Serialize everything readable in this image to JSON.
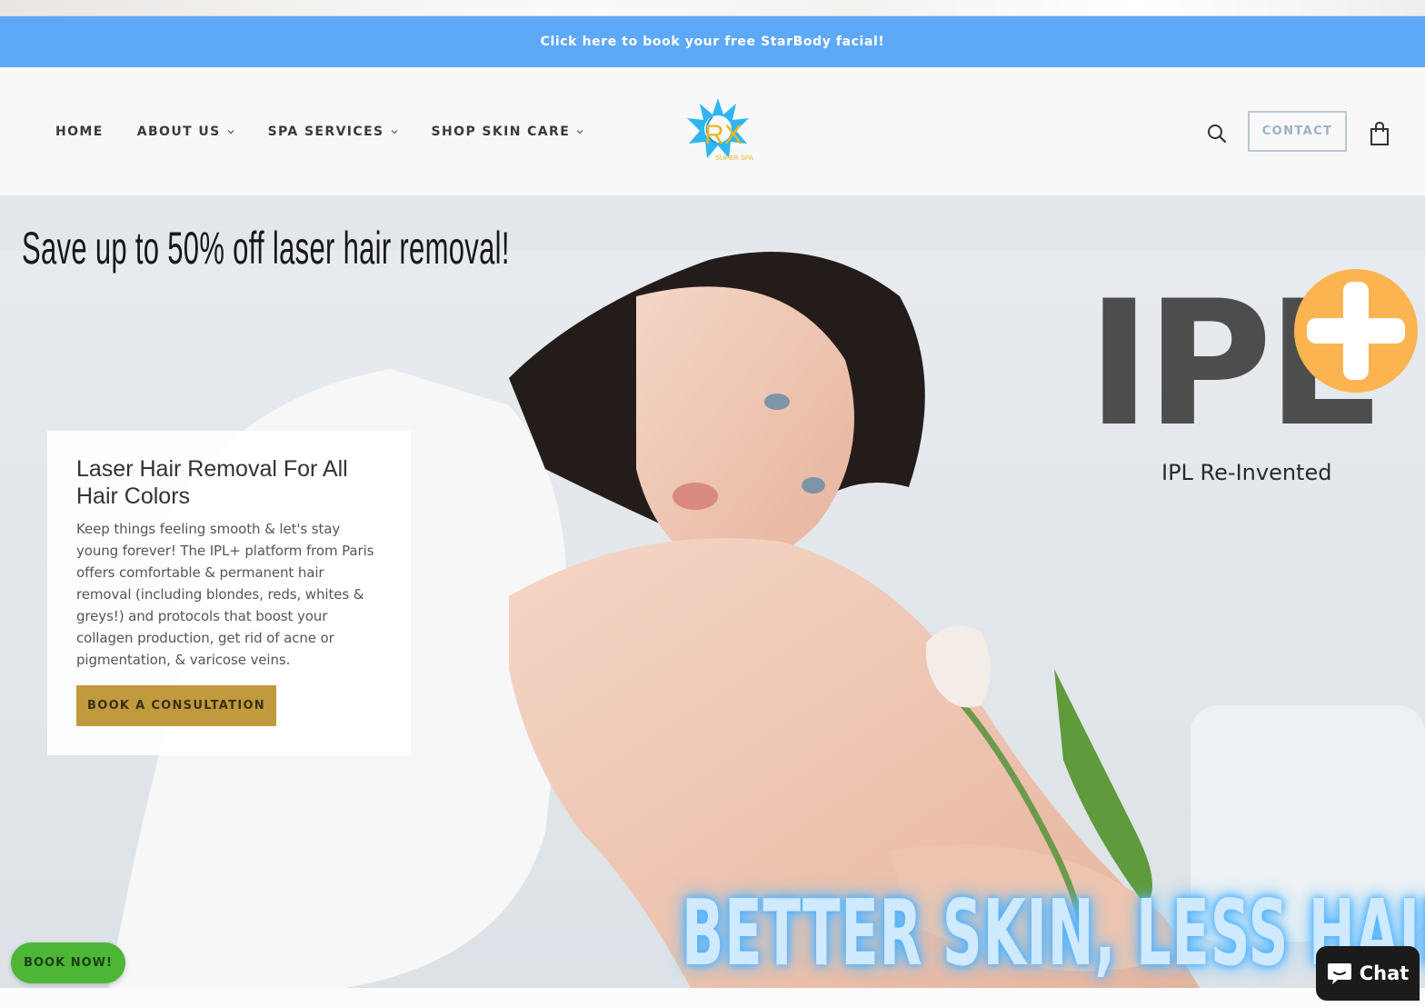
{
  "announcement": {
    "text": "Click here to book your free StarBody facial!"
  },
  "header": {
    "nav": [
      {
        "label": "HOME",
        "has_dropdown": false
      },
      {
        "label": "ABOUT US",
        "has_dropdown": true
      },
      {
        "label": "SPA SERVICES",
        "has_dropdown": true
      },
      {
        "label": "SHOP SKIN CARE",
        "has_dropdown": true
      }
    ],
    "logo": {
      "mark": "RX",
      "sub": "SUPER SPA"
    },
    "contact_label": "CONTACT",
    "icons": {
      "search": "search-icon",
      "cart": "shopping-bag-icon"
    }
  },
  "hero": {
    "headline": "Save up to 50% off laser hair removal!",
    "ipl_logo_text": "IPL",
    "ipl_tagline": "IPL Re-Invented",
    "slogan": "BETTER SKIN, LESS HAIR!",
    "card": {
      "title": "Laser Hair Removal For All Hair Colors",
      "body": "Keep things feeling smooth & let's stay young forever! The IPL+ platform from Paris offers comfortable & permanent hair removal (including blondes, reds, whites & greys!) and protocols that boost your collagen production, get rid of acne or pigmentation, & varicose veins.",
      "button_label": "BOOK A CONSULTATION"
    }
  },
  "floating": {
    "book_now_label": "BOOK NOW!",
    "chat_label": "Chat"
  },
  "colors": {
    "announcement_bg": "#5ea8f8",
    "consult_button": "#c19a3d",
    "book_now": "#4db636",
    "ipl_plus": "#fbb44f",
    "ipl_text": "#4d4d4d",
    "chat_bg": "#1b1b1b"
  }
}
